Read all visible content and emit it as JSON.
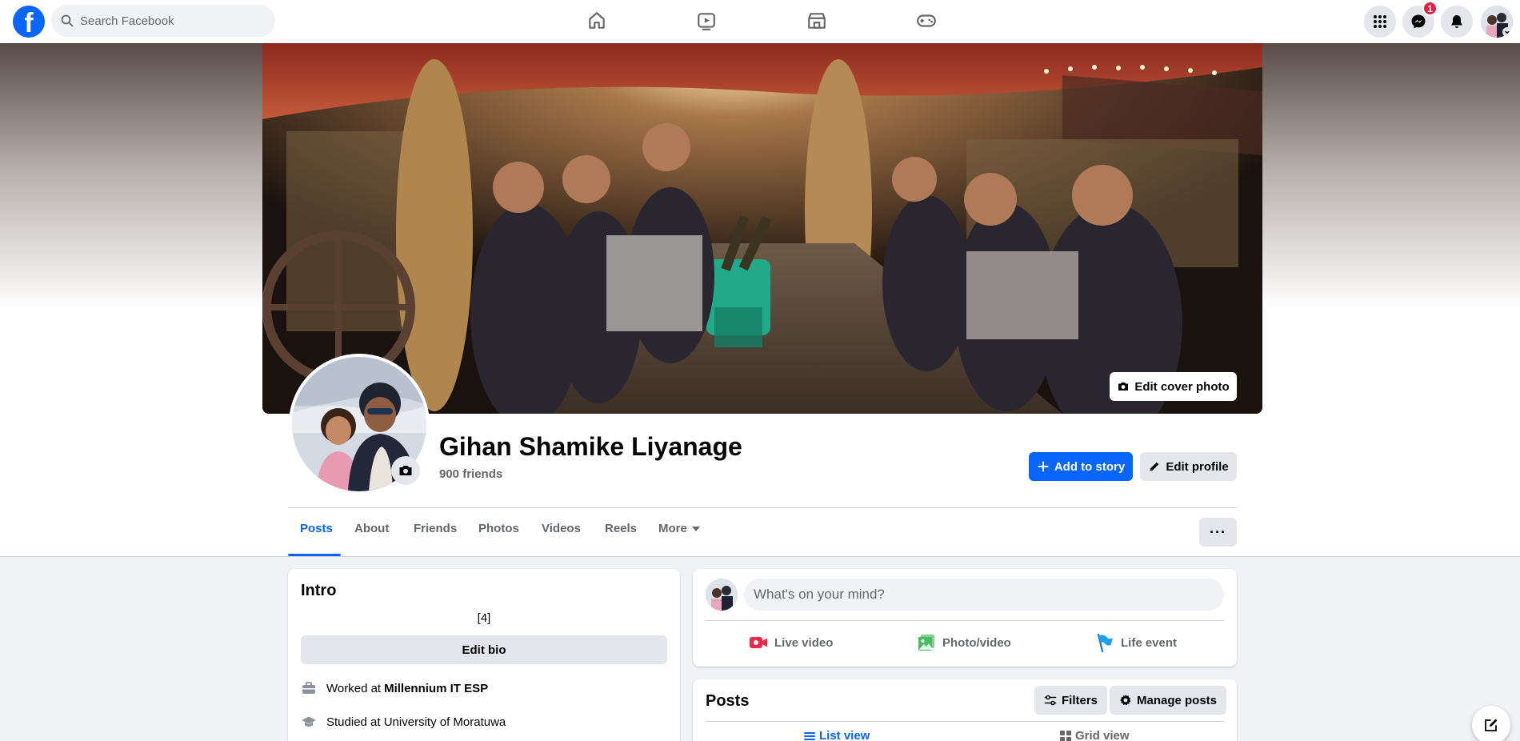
{
  "nav": {
    "logo_glyph": "f",
    "search_placeholder": "Search Facebook",
    "center_icons": [
      "home-icon",
      "video-icon",
      "marketplace-icon",
      "gaming-icon"
    ],
    "right_icons": [
      "menu-grid-icon",
      "messenger-icon",
      "notifications-icon"
    ],
    "messenger_badge": "1"
  },
  "profile": {
    "name": "Gihan Shamike Liyanage",
    "friends": "900 friends",
    "edit_cover_label": "Edit cover photo",
    "add_story_label": "Add to story",
    "edit_profile_label": "Edit profile"
  },
  "tabs": [
    {
      "label": "Posts",
      "active": true
    },
    {
      "label": "About"
    },
    {
      "label": "Friends"
    },
    {
      "label": "Photos"
    },
    {
      "label": "Videos"
    },
    {
      "label": "Reels"
    },
    {
      "label": "More"
    }
  ],
  "more_options_label": "···",
  "intro": {
    "title": "Intro",
    "bio": "[4]",
    "edit_bio_label": "Edit bio",
    "work_prefix": "Worked at",
    "work_place": "Millennium IT ESP",
    "study_text": "Studied at University of Moratuwa"
  },
  "composer": {
    "placeholder": "What's on your mind?",
    "actions": [
      "Live video",
      "Photo/video",
      "Life event"
    ]
  },
  "posts": {
    "title": "Posts",
    "filters_label": "Filters",
    "manage_label": "Manage posts",
    "list_view_label": "List view",
    "grid_view_label": "Grid view"
  },
  "colors": {
    "brand": "#0866ff",
    "badge": "#e41e3f",
    "background": "#f0f2f5"
  }
}
